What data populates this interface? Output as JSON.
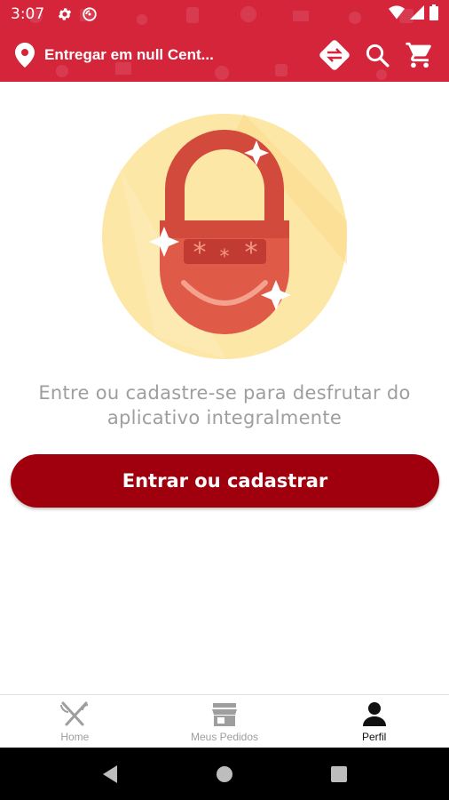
{
  "status_bar": {
    "time": "3:07",
    "icons": [
      "gear-icon",
      "no-disturb-icon"
    ],
    "right_icons": [
      "wifi-icon",
      "signal-icon",
      "battery-icon"
    ]
  },
  "header": {
    "address": "Entregar em null Cent...",
    "actions": [
      "swap-icon",
      "search-icon",
      "cart-icon"
    ]
  },
  "main": {
    "message": "Entre ou cadastre-se para desfrutar do aplicativo integralmente",
    "cta_label": "Entrar ou cadastrar"
  },
  "bottom_nav": {
    "items": [
      {
        "label": "Home",
        "icon": "utensils-icon",
        "active": false
      },
      {
        "label": "Meus Pedidos",
        "icon": "store-icon",
        "active": false
      },
      {
        "label": "Perfil",
        "icon": "person-icon",
        "active": true
      }
    ]
  },
  "colors": {
    "brand_red": "#d4253b",
    "cta_red": "#a0000e",
    "circle_yellow": "#fde7a6",
    "lock_red": "#e05a48"
  }
}
